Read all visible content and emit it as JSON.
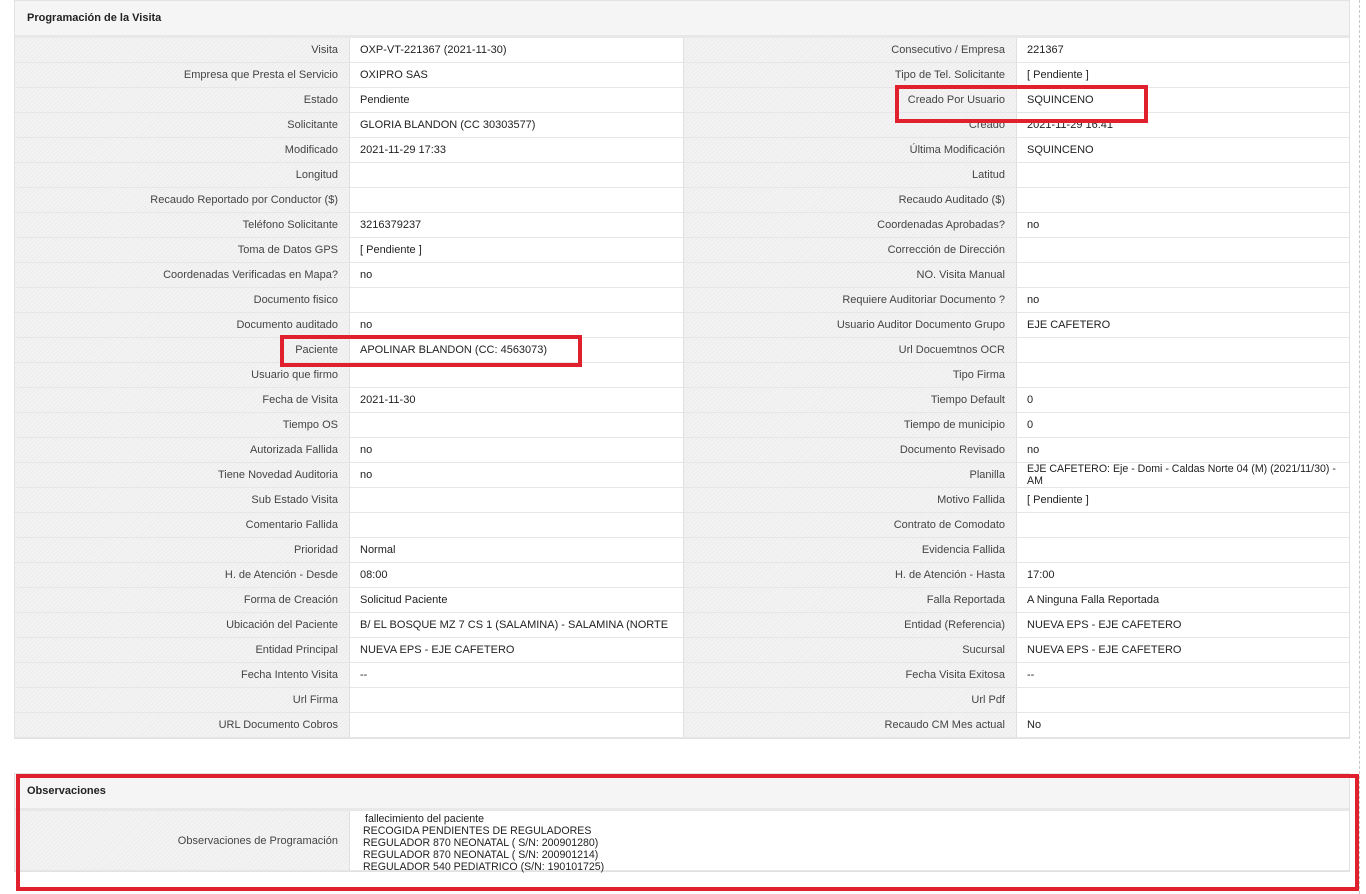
{
  "visit": {
    "title": "Programación de la Visita",
    "rows": [
      [
        "Visita",
        "OXP-VT-221367 (2021-11-30)",
        "Consecutivo / Empresa",
        "221367"
      ],
      [
        "Empresa que Presta el Servicio",
        "OXIPRO SAS",
        "Tipo de Tel. Solicitante",
        "[ Pendiente ]"
      ],
      [
        "Estado",
        "Pendiente",
        "Creado Por Usuario",
        "SQUINCENO"
      ],
      [
        "Solicitante",
        "GLORIA BLANDON (CC 30303577)",
        "Creado",
        "2021-11-29 16:41"
      ],
      [
        "Modificado",
        "2021-11-29 17:33",
        "Última Modificación",
        " SQUINCENO"
      ],
      [
        "Longitud",
        "",
        "Latitud",
        ""
      ],
      [
        "Recaudo Reportado por Conductor ($)",
        "",
        "Recaudo Auditado ($)",
        ""
      ],
      [
        "Teléfono Solicitante",
        "3216379237",
        "Coordenadas Aprobadas?",
        " no"
      ],
      [
        "Toma de Datos GPS",
        "[ Pendiente ]",
        "Corrección de Dirección",
        ""
      ],
      [
        "Coordenadas Verificadas en Mapa?",
        " no",
        "NO. Visita Manual",
        ""
      ],
      [
        "Documento fisico",
        "",
        "Requiere Auditoriar Documento ?",
        " no"
      ],
      [
        "Documento auditado",
        " no",
        "Usuario Auditor Documento Grupo",
        "EJE CAFETERO"
      ],
      [
        "Paciente",
        "APOLINAR BLANDON (CC: 4563073)",
        "Url Docuemtnos OCR",
        ""
      ],
      [
        "Usuario que firmo",
        "",
        "Tipo Firma",
        ""
      ],
      [
        "Fecha de Visita",
        " 2021-11-30",
        "Tiempo Default",
        "0"
      ],
      [
        "Tiempo OS",
        "",
        "Tiempo de municipio",
        "0"
      ],
      [
        "Autorizada Fallida",
        " no",
        "Documento Revisado",
        " no"
      ],
      [
        "Tiene Novedad Auditoria",
        " no",
        "Planilla",
        "EJE CAFETERO: Eje - Domi - Caldas Norte 04 (M) (2021/11/30) - AM"
      ],
      [
        "Sub Estado Visita",
        "",
        "Motivo Fallida",
        "[ Pendiente ]"
      ],
      [
        "Comentario Fallida",
        "",
        "Contrato de Comodato",
        ""
      ],
      [
        "Prioridad",
        "Normal",
        "Evidencia Fallida",
        ""
      ],
      [
        "H. de Atención - Desde",
        "08:00",
        "H. de Atención - Hasta",
        "17:00"
      ],
      [
        "Forma de Creación",
        "Solicitud Paciente",
        "Falla Reportada",
        "A Ninguna Falla Reportada"
      ],
      [
        "Ubicación del Paciente",
        "B/ EL BOSQUE MZ 7 CS 1 (SALAMINA) - SALAMINA (NORTE",
        "Entidad (Referencia)",
        "NUEVA EPS - EJE CAFETERO"
      ],
      [
        "Entidad Principal",
        "NUEVA EPS - EJE CAFETERO",
        "Sucursal",
        "NUEVA EPS - EJE CAFETERO"
      ],
      [
        "Fecha Intento Visita",
        " --",
        "Fecha Visita Exitosa",
        " --"
      ],
      [
        "Url Firma",
        "",
        "Url Pdf",
        ""
      ],
      [
        "URL Documento Cobros",
        "",
        "Recaudo CM Mes actual",
        "No"
      ]
    ]
  },
  "observations": {
    "title": "Observaciones",
    "label": "Observaciones de Programación",
    "lines": [
      "fallecimiento del paciente",
      "RECOGIDA PENDIENTES DE REGULADORES",
      "REGULADOR 870 NEONATAL ( S/N: 200901280)",
      "REGULADOR 870 NEONATAL ( S/N: 200901214)",
      "REGULADOR 540 PEDIATRICO (S/N: 190101725)"
    ]
  },
  "colors": {
    "highlight": "#e0202c",
    "label_bg": "#f3f3f3",
    "header_bg": "#f5f5f5"
  }
}
